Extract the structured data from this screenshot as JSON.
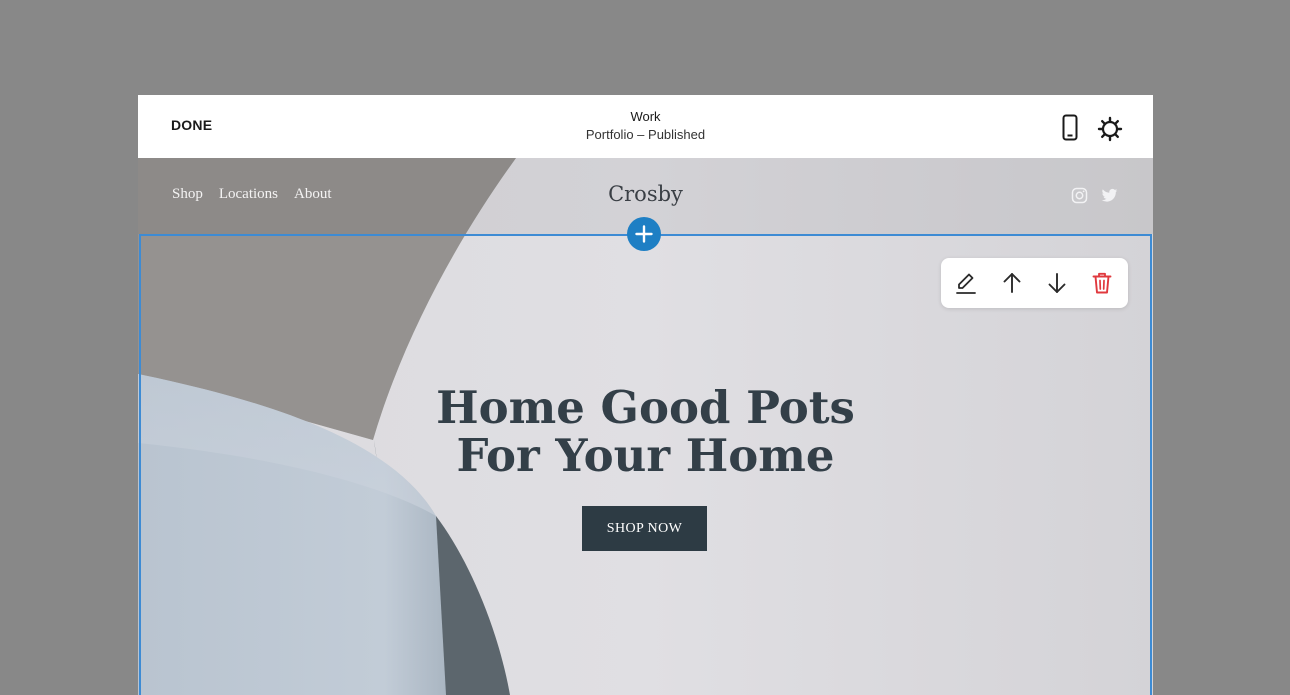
{
  "editor": {
    "done_label": "DONE",
    "page_title": "Work",
    "page_status": "Portfolio – Published",
    "icons": {
      "mobile": "mobile-phone-icon",
      "settings": "gear-icon"
    }
  },
  "site": {
    "nav": [
      {
        "label": "Shop"
      },
      {
        "label": "Locations"
      },
      {
        "label": "About"
      }
    ],
    "brand": "Crosby",
    "socials": [
      "instagram-icon",
      "twitter-icon"
    ],
    "hero": {
      "headline_line1": "Home Good Pots",
      "headline_line2": "For Your Home",
      "cta_label": "SHOP NOW"
    }
  },
  "section_toolbar": [
    "edit-icon",
    "move-up-icon",
    "move-down-icon",
    "delete-icon"
  ],
  "colors": {
    "accent": "#1e7fc4",
    "selection": "#3d8bd4",
    "delete": "#e0393e",
    "cta_bg": "#2d3b44",
    "headline": "#333f48"
  }
}
